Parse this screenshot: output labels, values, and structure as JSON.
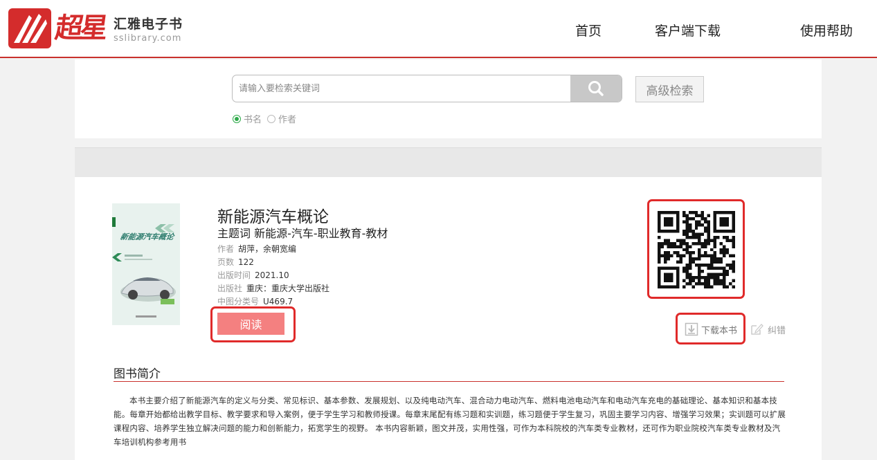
{
  "header": {
    "brand_title": "汇雅电子书",
    "brand_url": "sslibrary.com",
    "brand_logo_text": "超星",
    "nav": [
      "首页",
      "客户端下载",
      "使用帮助"
    ]
  },
  "search": {
    "placeholder": "请输入要检索关键词",
    "advanced_label": "高级检索",
    "options": [
      "书名",
      "作者"
    ],
    "selected": "书名"
  },
  "book": {
    "title": "新能源汽车概论",
    "subject_label": "主题词",
    "subject_value": "新能源-汽车-职业教育-教材",
    "meta": [
      {
        "key": "作者",
        "value": "胡萍，余朝宽编"
      },
      {
        "key": "页数",
        "value": "122"
      },
      {
        "key": "出版时间",
        "value": "2021.10"
      },
      {
        "key": "出版社",
        "value": "重庆：重庆大学出版社"
      },
      {
        "key": "中图分类号",
        "value": "U469.7"
      }
    ],
    "cover_title": "新能源汽车概论",
    "read_label": "阅读",
    "download_label": "下载本书",
    "correct_label": "纠错"
  },
  "intro": {
    "heading": "图书简介",
    "text": "本书主要介绍了新能源汽车的定义与分类、常见标识、基本参数、发展规划、以及纯电动汽车、混合动力电动汽车、燃料电池电动汽车和电动汽车充电的基础理论、基本知识和基本技能。每章开始都给出教学目标、教学要求和导入案例，便于学生学习和教师授课。每章末尾配有练习题和实训题，练习题便于学生复习，巩固主要学习内容、增强学习效果；实训题可以扩展课程内容、培养学生独立解决问题的能力和创新能力，拓宽学生的视野。 本书内容新颖，图文并茂，实用性强，可作为本科院校的汽车类专业教材，还可作为职业院校汽车类专业教材及汽车培训机构参考用书"
  },
  "colors": {
    "accent_red": "#c9302c",
    "read_button": "#f48080",
    "radio_green": "#2eaa4a"
  }
}
